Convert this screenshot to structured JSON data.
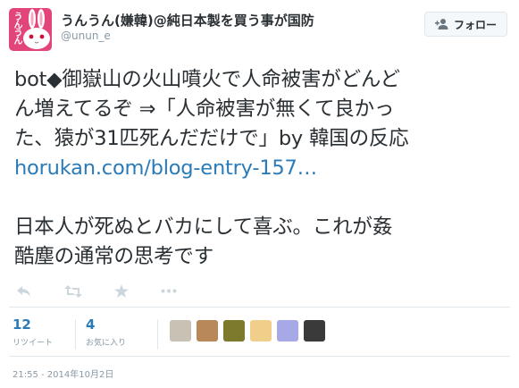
{
  "header": {
    "display_name": "うんうん(嫌韓)@純日本製を買う事が国防",
    "screen_name": "@unun_e",
    "avatar_text": "うんうん",
    "follow_label": "フォロー"
  },
  "tweet": {
    "lines": [
      "bot◆御嶽山の火山噴火で人命被害がどんど",
      "ん増えてるぞ ⇒「人命被害が無くて良かっ",
      "た、猿が31匹死んだだけで」by 韓国の反応"
    ],
    "link": "horukan.com/blog-entry-157…",
    "lines2": [
      "日本人が死ぬとバカにして喜ぶ。これが姦",
      "酷塵の通常の思考です"
    ]
  },
  "actions": {
    "reply_icon": "reply-icon",
    "retweet_icon": "retweet-icon",
    "favorite_icon": "star-icon",
    "more_icon": "more-icon"
  },
  "stats": {
    "retweets": {
      "count": "12",
      "label": "リツイート"
    },
    "favorites": {
      "count": "4",
      "label": "お気に入り"
    }
  },
  "favoriters": [
    {
      "name": "favoriter-avatar-1",
      "color": "#c9c1b4"
    },
    {
      "name": "favoriter-avatar-2",
      "color": "#b8875a"
    },
    {
      "name": "favoriter-avatar-3",
      "color": "#7d7a2e"
    },
    {
      "name": "favoriter-avatar-4",
      "color": "#f0cf8a"
    },
    {
      "name": "favoriter-avatar-5",
      "color": "#a7a8e6"
    },
    {
      "name": "favoriter-avatar-6",
      "color": "#3a3a3a"
    }
  ],
  "timestamp": "21:55 - 2014年10月2日",
  "colors": {
    "link": "#2b7bb9",
    "muted": "#8899a6",
    "avatar_bg": "#e2457a"
  }
}
